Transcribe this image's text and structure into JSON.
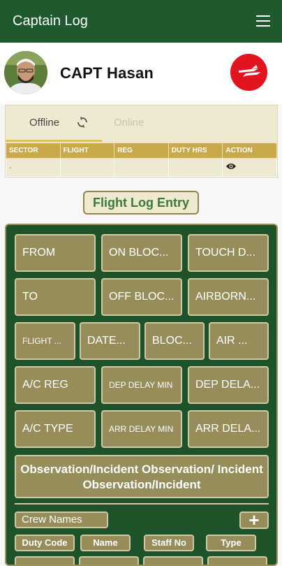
{
  "appbar": {
    "title": "Captain Log",
    "menu_icon": "hamburger-menu-icon"
  },
  "profile": {
    "name": "CAPT  Hasan",
    "logo_color": "#e1141f"
  },
  "tabs": {
    "offline": "Offline",
    "online": "Online"
  },
  "table": {
    "headers": [
      "SECTOR",
      "FLIGHT",
      "REG",
      "DUTY HRS",
      "ACTION"
    ],
    "rows": [
      [
        "-",
        "",
        "",
        "",
        "eye-icon"
      ]
    ]
  },
  "entry_button": "Flight Log Entry",
  "form": {
    "fields": [
      "FROM",
      "ON BLOC...",
      "TOUCH D...",
      "TO",
      "OFF BLOC...",
      "AIRBORN...",
      "FLIGHT ...",
      "DATE...",
      "BLOC...",
      "AIR ...",
      "A/C REG",
      "DEP DELAY MIN",
      "DEP DELA...",
      "A/C TYPE",
      "ARR DELAY MIN",
      "ARR DELA..."
    ],
    "observation": "Observation/Incident Observation/ Incident Observation/Incident",
    "crew_names": "Crew Names",
    "add_label": "+",
    "crew_columns": [
      "Duty Code",
      "Name",
      "Staff No",
      "Type"
    ]
  },
  "colors": {
    "primary": "#1f5a2f",
    "accent": "#c9a94a",
    "field": "#968d5a"
  }
}
